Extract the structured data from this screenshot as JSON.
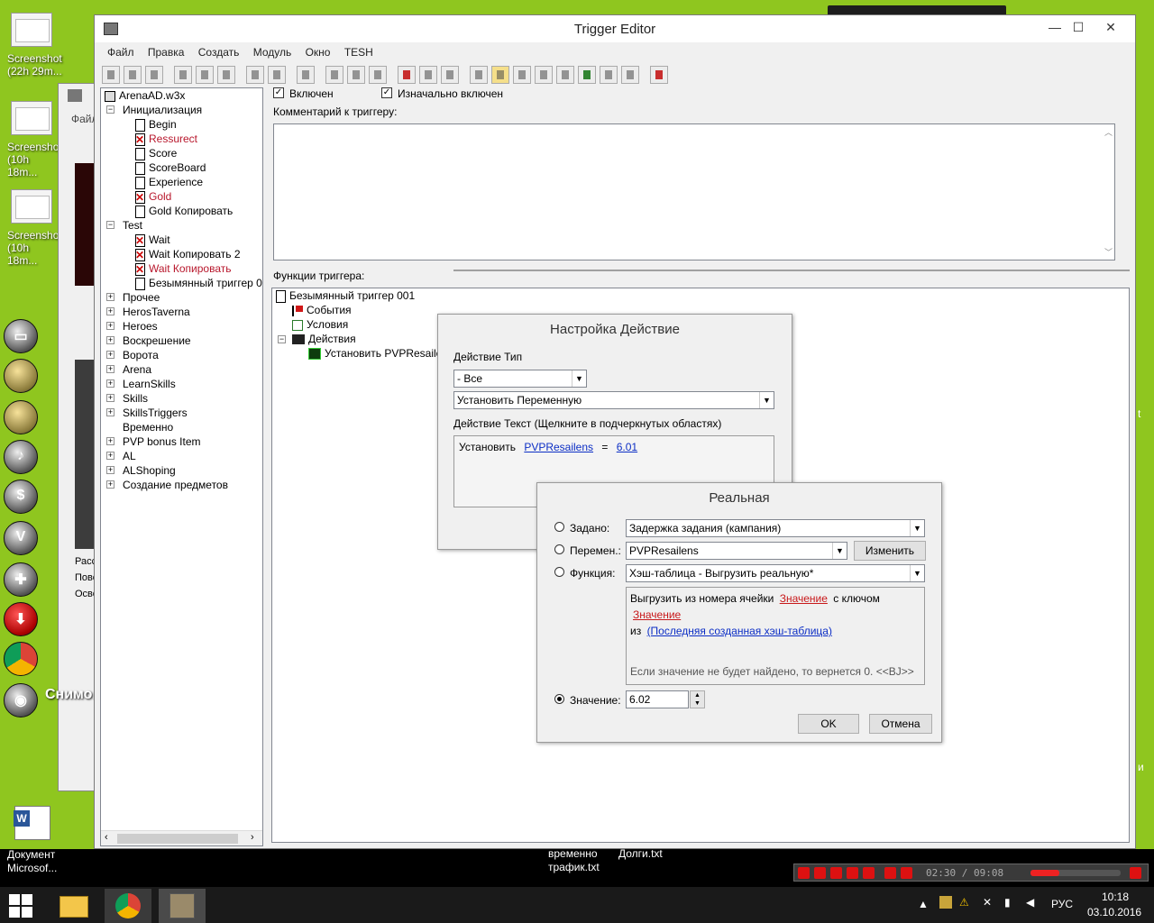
{
  "desktop": {
    "icons": [
      {
        "label": "Screenshot (22h 29m..."
      },
      {
        "label": "Screenshot (10h 18m..."
      },
      {
        "label": "Screenshot (10h 18m..."
      }
    ],
    "snapshot_label": "Снимок экрана",
    "word_doc_label": "Документ Microsof...",
    "file1": "временно трафик.txt",
    "file2": "Долги.txt",
    "bg_window_menu": "Файл",
    "bg_window_items": [
      "Расс",
      "Пово",
      "Осве"
    ],
    "right_edge_a": "t",
    "right_edge_b": "и"
  },
  "window": {
    "title": "Trigger Editor",
    "min": "—",
    "max": "☐",
    "close": "✕"
  },
  "menu": [
    "Файл",
    "Правка",
    "Создать",
    "Модуль",
    "Окно",
    "TESH"
  ],
  "tree": {
    "root": "ArenaAD.w3x",
    "items": [
      {
        "label": "Инициализация",
        "kind": "folder",
        "level": 1,
        "exp": "−"
      },
      {
        "label": "Begin",
        "kind": "doc",
        "level": 2
      },
      {
        "label": "Ressurect",
        "kind": "docx",
        "level": 2,
        "disabled": true
      },
      {
        "label": "Score",
        "kind": "doc",
        "level": 2
      },
      {
        "label": "ScoreBoard",
        "kind": "doc",
        "level": 2
      },
      {
        "label": "Experience",
        "kind": "doc",
        "level": 2
      },
      {
        "label": "Gold",
        "kind": "docx",
        "level": 2,
        "disabled": true
      },
      {
        "label": "Gold Копировать",
        "kind": "doc",
        "level": 2
      },
      {
        "label": "Test",
        "kind": "folder",
        "level": 1,
        "exp": "−"
      },
      {
        "label": "Wait",
        "kind": "docx",
        "level": 2
      },
      {
        "label": "Wait Копировать 2",
        "kind": "docx",
        "level": 2
      },
      {
        "label": "Wait Копировать",
        "kind": "docx",
        "level": 2,
        "disabled": true
      },
      {
        "label": "Безымянный триггер 0",
        "kind": "doc",
        "level": 2
      },
      {
        "label": "Прочее",
        "kind": "folder",
        "level": 1,
        "exp": "+"
      },
      {
        "label": "HerosTaverna",
        "kind": "folder",
        "level": 1,
        "exp": "+"
      },
      {
        "label": "Heroes",
        "kind": "folder",
        "level": 1,
        "exp": "+"
      },
      {
        "label": "Воскрешение",
        "kind": "folder",
        "level": 1,
        "exp": "+"
      },
      {
        "label": "Ворота",
        "kind": "folder",
        "level": 1,
        "exp": "+"
      },
      {
        "label": "Arena",
        "kind": "folder",
        "level": 1,
        "exp": "+"
      },
      {
        "label": "LearnSkills",
        "kind": "folder",
        "level": 1,
        "exp": "+"
      },
      {
        "label": "Skills",
        "kind": "folder",
        "level": 1,
        "exp": "+"
      },
      {
        "label": "SkillsTriggers",
        "kind": "folder",
        "level": 1,
        "exp": "+"
      },
      {
        "label": "Временно",
        "kind": "folder",
        "level": 1,
        "exp": ""
      },
      {
        "label": "PVP bonus Item",
        "kind": "folder",
        "level": 1,
        "exp": "+"
      },
      {
        "label": "AL",
        "kind": "folder",
        "level": 1,
        "exp": "+"
      },
      {
        "label": "ALShoping",
        "kind": "folder",
        "level": 1,
        "exp": "+"
      },
      {
        "label": "Создание предметов",
        "kind": "folder",
        "level": 1,
        "exp": "+"
      }
    ]
  },
  "trigger": {
    "enabled_label": "Включен",
    "initially_enabled_label": "Изначально включен",
    "comment_label": "Комментарий к триггеру:",
    "functions_label": "Функции триггера:",
    "func_tree": {
      "name": "Безымянный триггер 001",
      "events": "События",
      "conditions": "Условия",
      "actions": "Действия",
      "action_item": "Установить PVPResailens"
    }
  },
  "action_dialog": {
    "title": "Настройка Действие",
    "type_label": "Действие Тип",
    "type_value": "- Все",
    "action_value": "Установить Переменную",
    "text_label": "Действие Текст (Щелкните в подчеркнутых областях)",
    "text_prefix": "Установить",
    "var_link": "PVPResailens",
    "eq": "=",
    "value_link": "6.01"
  },
  "real_dialog": {
    "title": "Реальная",
    "preset_label": "Задано:",
    "preset_value": "Задержка задания (кампания)",
    "var_label": "Перемен.:",
    "var_value": "PVPResailens",
    "edit_button": "Изменить",
    "func_label": "Функция:",
    "func_value": "Хэш-таблица - Выгрузить реальную*",
    "desc_prefix": "Выгрузить из номера ячейки",
    "desc_link1": "Значение",
    "desc_mid": "с ключом",
    "desc_link2": "Значение",
    "desc_from": "из",
    "desc_link3": "(Последняя созданная хэш-таблица)",
    "note": "Если значение не будет найдено, то вернется 0. <<BJ>>",
    "value_label": "Значение:",
    "value_input": "6.02",
    "ok": "OK",
    "cancel": "Отмена"
  },
  "media_player": {
    "time": "02:30 / 09:08"
  },
  "taskbar": {
    "lang": "РУС",
    "time": "10:18",
    "date": "03.10.2016"
  }
}
